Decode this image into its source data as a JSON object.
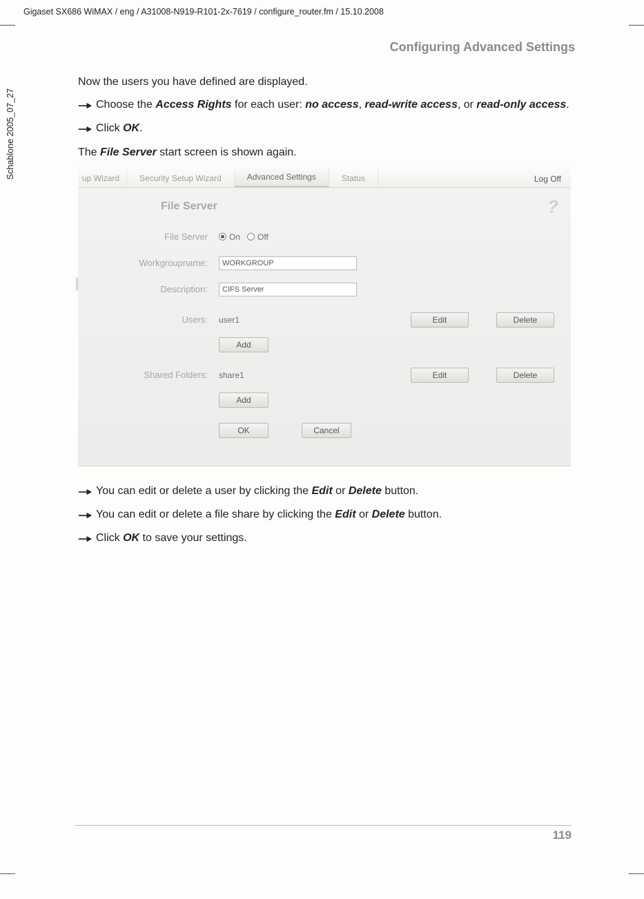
{
  "meta": {
    "header_path": "Gigaset SX686 WiMAX / eng / A31008-N919-R101-2x-7619 / configure_router.fm / 15.10.2008",
    "side_label": "Schablone 2005_07_27",
    "section_title": "Configuring Advanced Settings",
    "page_number": "119"
  },
  "body": {
    "p1": "Now the users you have defined are displayed.",
    "b1_pre": "Choose the ",
    "b1_ar": "Access Rights",
    "b1_mid1": " for each user: ",
    "b1_na": "no access",
    "b1_c1": ", ",
    "b1_rw": "read-write access",
    "b1_c2": ", or ",
    "b1_ro": "read-only access",
    "b1_end": ".",
    "b2_pre": "Click ",
    "b2_ok": "OK",
    "b2_end": ".",
    "p2_pre": "The ",
    "p2_fs": "File Server",
    "p2_end": " start screen is shown again.",
    "b3_pre": "You can edit or delete a user by clicking the ",
    "b3_edit": "Edit",
    "b3_or": " or ",
    "b3_del": "Delete",
    "b3_end": " button.",
    "b4_pre": "You can edit or delete a file share by clicking the ",
    "b4_edit": "Edit",
    "b4_or": " or ",
    "b4_del": "Delete",
    "b4_end": " button.",
    "b5_pre": "Click ",
    "b5_ok": "OK",
    "b5_end": " to save your settings."
  },
  "ui": {
    "tabs": {
      "t1": "up Wizard",
      "t2": "Security Setup Wizard",
      "t3": "Advanced Settings",
      "t4": "Status"
    },
    "logoff": "Log Off",
    "panel_title": "File Server",
    "help": "?",
    "labels": {
      "file_server": "File Server",
      "workgroup": "Workgroupname:",
      "description": "Description:",
      "users": "Users:",
      "shared": "Shared Folders:"
    },
    "radio": {
      "on": "On",
      "off": "Off"
    },
    "inputs": {
      "workgroup": "WORKGROUP",
      "description": "CIFS Server"
    },
    "rows": {
      "user": "user1",
      "share": "share1"
    },
    "buttons": {
      "edit": "Edit",
      "delete": "Delete",
      "add": "Add",
      "ok": "OK",
      "cancel": "Cancel"
    }
  }
}
